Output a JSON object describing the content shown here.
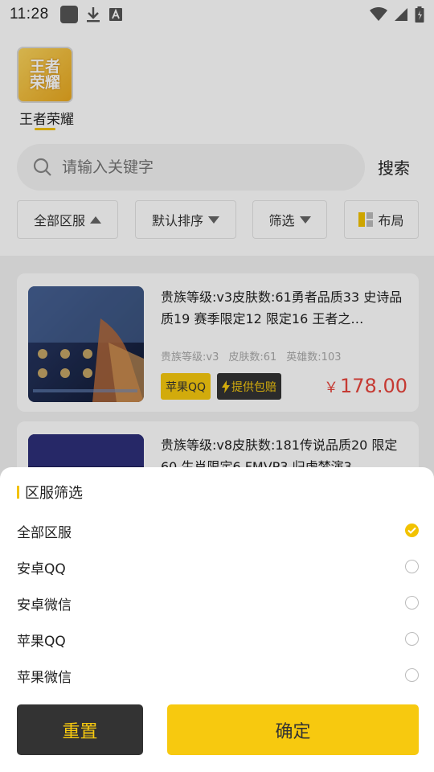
{
  "status_bar": {
    "time": "11:28"
  },
  "header": {
    "game_logo_text": "王者\n荣耀",
    "game_name": "王者荣耀"
  },
  "search": {
    "placeholder": "请输入关键字",
    "button_label": "搜索"
  },
  "filters": {
    "server": "全部区服",
    "sort": "默认排序",
    "filter": "筛选",
    "layout": "布局"
  },
  "listings": [
    {
      "title": "贵族等级:v3皮肤数:61勇者品质33 史诗品质19 赛季限定12 限定16 王者之…",
      "stats": [
        "贵族等级:v3",
        "皮肤数:61",
        "英雄数:103"
      ],
      "tag_platform": "苹果QQ",
      "tag_compensation": "提供包赔",
      "price_symbol": "￥",
      "price": "178.00"
    },
    {
      "title": "贵族等级:v8皮肤数:181传说品质20 限定60 生肖限定6 FMVP3 归虚梦演3 …",
      "stats": [],
      "tag_platform": "",
      "tag_compensation": "",
      "price_symbol": "",
      "price": ""
    }
  ],
  "sheet": {
    "title": "区服筛选",
    "options": [
      {
        "label": "全部区服",
        "selected": true
      },
      {
        "label": "安卓QQ",
        "selected": false
      },
      {
        "label": "安卓微信",
        "selected": false
      },
      {
        "label": "苹果QQ",
        "selected": false
      },
      {
        "label": "苹果微信",
        "selected": false
      }
    ],
    "reset_label": "重置",
    "confirm_label": "确定"
  },
  "colors": {
    "accent": "#f7c90f",
    "price": "#e8453c",
    "dark": "#333333"
  }
}
